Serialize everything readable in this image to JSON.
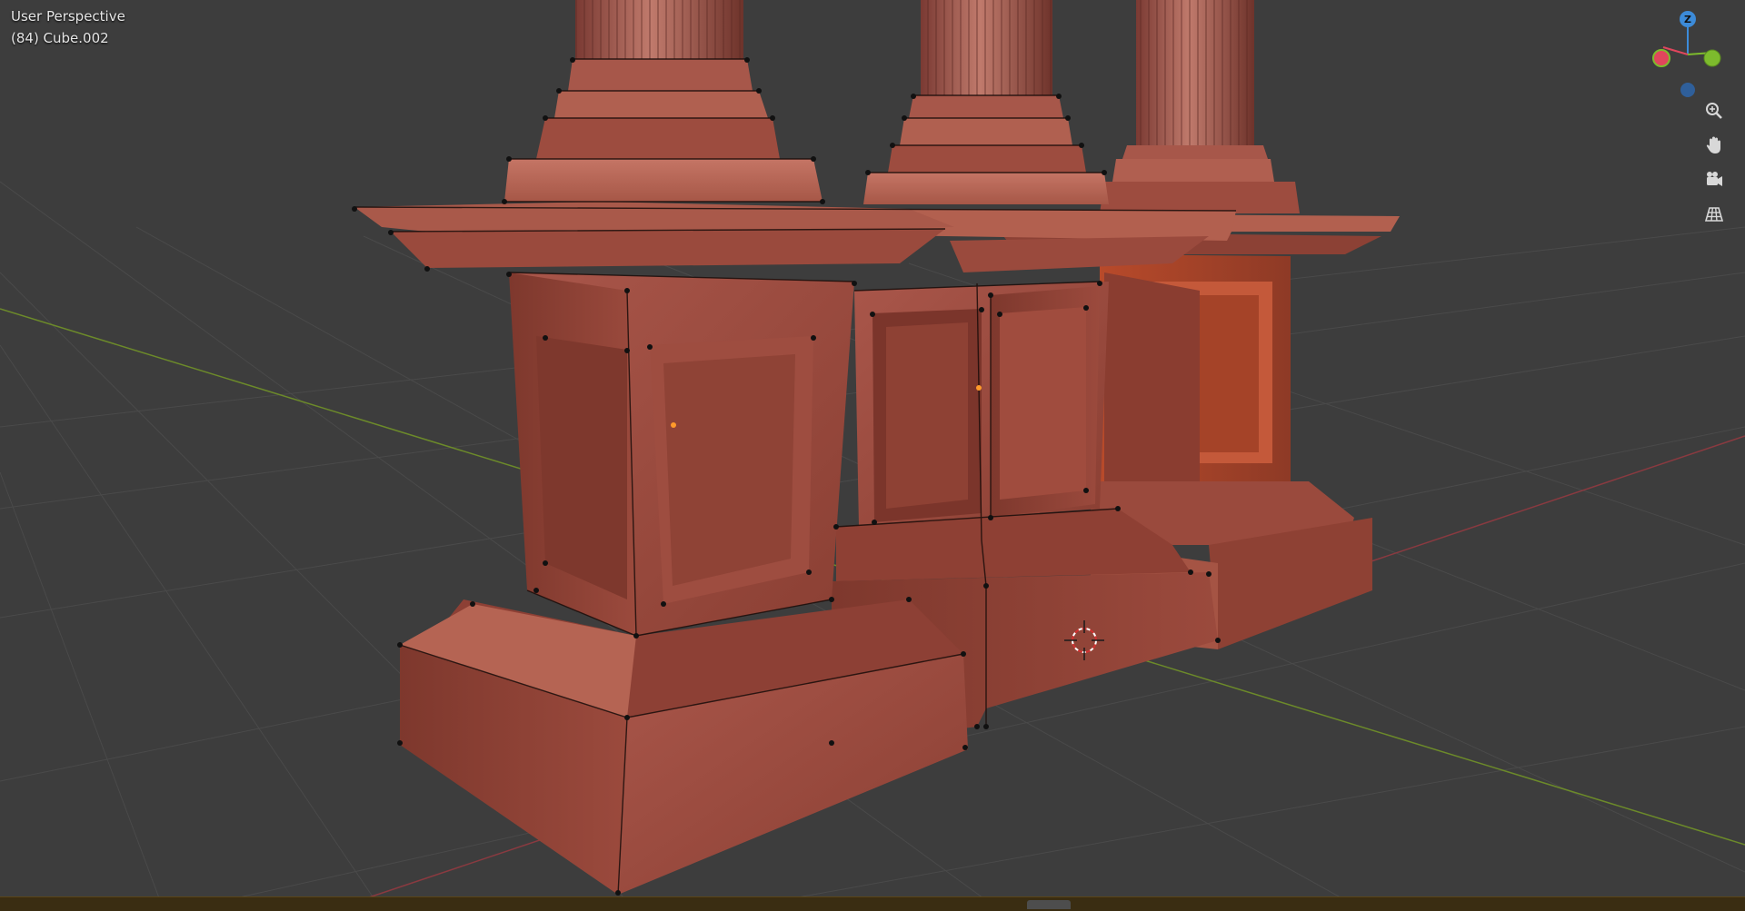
{
  "viewport": {
    "view_name": "User Perspective",
    "object_info": "(84) Cube.002"
  },
  "gizmo": {
    "axis_z_label": "Z",
    "colors": {
      "x": "#e0465c",
      "y": "#7dbb2d",
      "z": "#3c8bd9"
    },
    "nav_icons": [
      "zoom-icon",
      "hand-icon",
      "camera-icon",
      "grid-icon"
    ]
  },
  "colors": {
    "background": "#3d3d3d",
    "grid": "#4a4a4a",
    "x_axis": "#8a3a40",
    "y_axis": "#6c8a2a",
    "mesh_main": "#9e4b3c",
    "mesh_dark": "#6b2f26",
    "mesh_light": "#b86453",
    "vertex": "#111111",
    "origin": "#ff9a2a",
    "statusbar": "#3a2d12"
  },
  "cursor": {
    "name": "3d-cursor"
  }
}
